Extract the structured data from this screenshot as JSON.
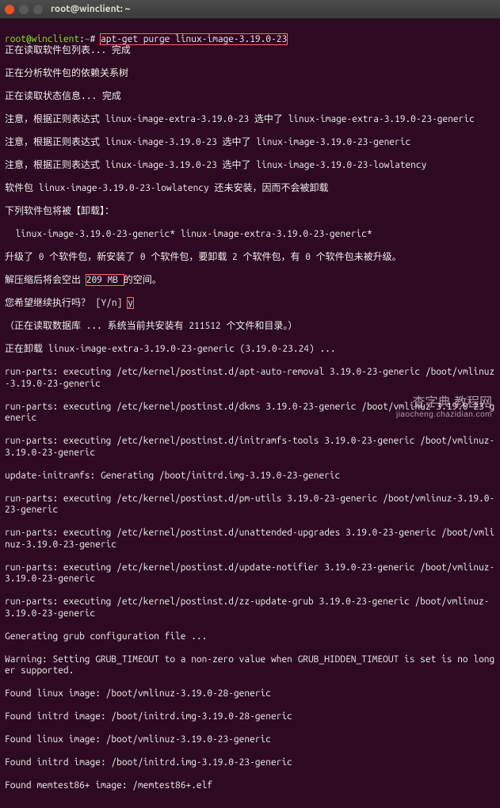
{
  "window": {
    "title": "root@winclient: ~"
  },
  "prompt": {
    "user": "root",
    "host": "winclient",
    "path": "~",
    "sep": "@",
    "colon": ":",
    "hash": "# "
  },
  "cmd": "apt-get purge linux-image-3.19.0-23",
  "lines": {
    "l01": "正在读取软件包列表... 完成",
    "l02": "正在分析软件包的依赖关系树",
    "l03": "正在读取状态信息... 完成",
    "l04": "注意，根据正则表达式 linux-image-extra-3.19.0-23 选中了 linux-image-extra-3.19.0-23-generic",
    "l05": "注意，根据正则表达式 linux-image-3.19.0-23 选中了 linux-image-3.19.0-23-generic",
    "l06": "注意，根据正则表达式 linux-image-3.19.0-23 选中了 linux-image-3.19.0-23-lowlatency",
    "l07": "软件包 linux-image-3.19.0-23-lowlatency 还未安装，因而不会被卸载",
    "l08": "下列软件包将被【卸载】：",
    "l09": "  linux-image-3.19.0-23-generic* linux-image-extra-3.19.0-23-generic*",
    "l10": "升级了 0 个软件包，新安装了 0 个软件包，要卸载 2 个软件包，有 0 个软件包未被升级。",
    "l11a": "解压缩后将会空出 ",
    "l11b": "209 MB ",
    "l11c": "的空间。",
    "l12a": "您希望继续执行吗？ [Y/n] ",
    "l12b": "y",
    "l13": "（正在读取数据库 ... 系统当前共安装有 211512 个文件和目录。）",
    "l14": "正在卸载 linux-image-extra-3.19.0-23-generic (3.19.0-23.24) ...",
    "l15": "run-parts: executing /etc/kernel/postinst.d/apt-auto-removal 3.19.0-23-generic /boot/vmlinuz-3.19.0-23-generic",
    "l16": "run-parts: executing /etc/kernel/postinst.d/dkms 3.19.0-23-generic /boot/vmlinuz-3.19.0-23-generic",
    "l17": "run-parts: executing /etc/kernel/postinst.d/initramfs-tools 3.19.0-23-generic /boot/vmlinuz-3.19.0-23-generic",
    "l18": "update-initramfs: Generating /boot/initrd.img-3.19.0-23-generic",
    "l19": "run-parts: executing /etc/kernel/postinst.d/pm-utils 3.19.0-23-generic /boot/vmlinuz-3.19.0-23-generic",
    "l20": "run-parts: executing /etc/kernel/postinst.d/unattended-upgrades 3.19.0-23-generic /boot/vmlinuz-3.19.0-23-generic",
    "l21": "run-parts: executing /etc/kernel/postinst.d/update-notifier 3.19.0-23-generic /boot/vmlinuz-3.19.0-23-generic",
    "l22": "run-parts: executing /etc/kernel/postinst.d/zz-update-grub 3.19.0-23-generic /boot/vmlinuz-3.19.0-23-generic",
    "l23": "Generating grub configuration file ...",
    "l24": "Warning: Setting GRUB_TIMEOUT to a non-zero value when GRUB_HIDDEN_TIMEOUT is set is no longer supported.",
    "l25": "Found linux image: /boot/vmlinuz-3.19.0-28-generic",
    "l26": "Found initrd image: /boot/initrd.img-3.19.0-28-generic",
    "l27": "Found linux image: /boot/vmlinuz-3.19.0-23-generic",
    "l28": "Found initrd image: /boot/initrd.img-3.19.0-23-generic",
    "l29": "Found memtest86+ image: /memtest86+.elf"
  },
  "watermark": {
    "a": "查字典 教程网",
    "b": "jiaocheng.chazidian.com"
  }
}
